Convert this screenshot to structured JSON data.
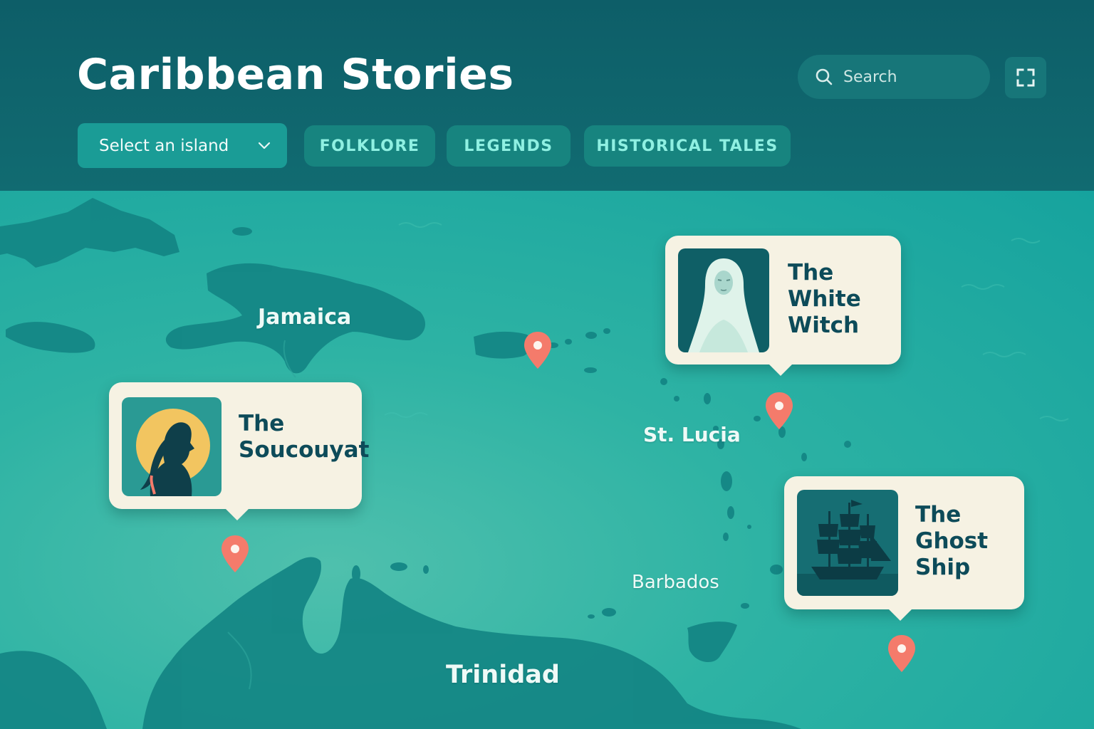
{
  "app": {
    "title": "Caribbean Stories"
  },
  "search": {
    "placeholder": "Search",
    "icon": "search-icon"
  },
  "toolbar": {
    "fullscreen_icon": "fullscreen-icon"
  },
  "filters": {
    "island_select": {
      "selected": "Select an island",
      "icon": "chevron-down-icon"
    },
    "tags": [
      {
        "label": "FOLKLORE"
      },
      {
        "label": "LEGENDS"
      },
      {
        "label": "HISTORICAL TALES"
      }
    ]
  },
  "map": {
    "labels": {
      "jamaica": "Jamaica",
      "st_lucia": "St. Lucia",
      "barbados": "Barbados",
      "trinidad": "Trinidad"
    },
    "stories": [
      {
        "title": "The\nSoucouyat",
        "image": "soucouyat-illustration"
      },
      {
        "title": "The\nWhite\nWitch",
        "image": "white-witch-illustration"
      },
      {
        "title": "The\nGhost\nShip",
        "image": "ghost-ship-illustration"
      }
    ],
    "pin_icon": "map-pin-icon"
  },
  "colors": {
    "header": "#0d5e68",
    "sea": "#17a39a",
    "land": "#138584",
    "card": "#f6f2e3",
    "card_text": "#0d4b59",
    "tag_text": "#8ff0e2",
    "pin": "#f47b6b"
  }
}
